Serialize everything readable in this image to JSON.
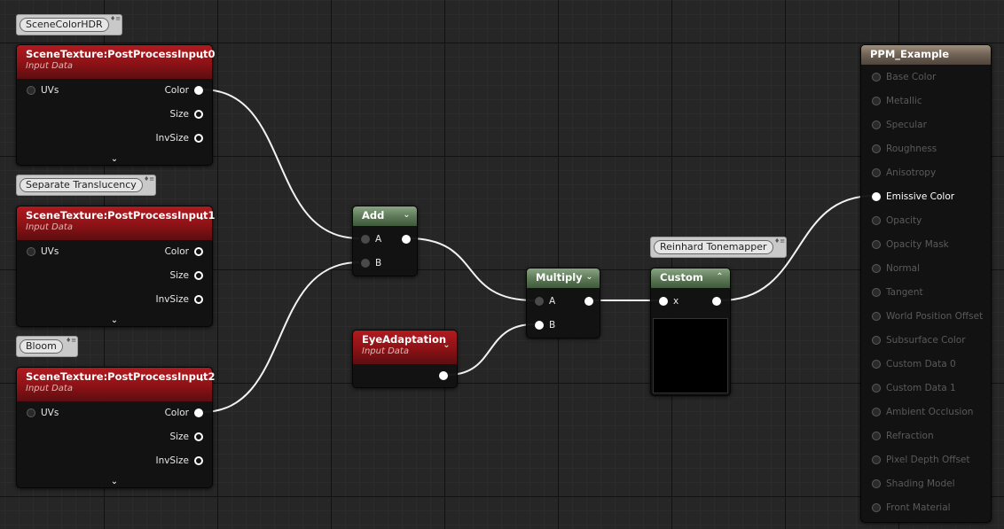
{
  "comments": {
    "scene_color_hdr": "SceneColorHDR",
    "separate_translucency": "Separate Translucency",
    "bloom": "Bloom",
    "reinhard": "Reinhard Tonemapper"
  },
  "comment_marker": "♦≡",
  "nodes": {
    "scene_texture_0": {
      "title": "SceneTexture:PostProcessInput0",
      "subtitle": "Input Data",
      "input_uvs": "UVs",
      "output_color": "Color",
      "output_size": "Size",
      "output_invsize": "InvSize"
    },
    "scene_texture_1": {
      "title": "SceneTexture:PostProcessInput1",
      "subtitle": "Input Data",
      "input_uvs": "UVs",
      "output_color": "Color",
      "output_size": "Size",
      "output_invsize": "InvSize"
    },
    "scene_texture_2": {
      "title": "SceneTexture:PostProcessInput2",
      "subtitle": "Input Data",
      "input_uvs": "UVs",
      "output_color": "Color",
      "output_size": "Size",
      "output_invsize": "InvSize"
    },
    "add": {
      "title": "Add",
      "input_a": "A",
      "input_b": "B"
    },
    "eye_adaptation": {
      "title": "EyeAdaptation",
      "subtitle": "Input Data"
    },
    "multiply": {
      "title": "Multiply",
      "input_a": "A",
      "input_b": "B"
    },
    "custom": {
      "title": "Custom",
      "input_x": "x"
    },
    "material_result": {
      "title": "PPM_Example",
      "active_pin": "Emissive Color",
      "pins": [
        "Base Color",
        "Metallic",
        "Specular",
        "Roughness",
        "Anisotropy",
        "Emissive Color",
        "Opacity",
        "Opacity Mask",
        "Normal",
        "Tangent",
        "World Position Offset",
        "Subsurface Color",
        "Custom Data 0",
        "Custom Data 1",
        "Ambient Occlusion",
        "Refraction",
        "Pixel Depth Offset",
        "Shading Model",
        "Front Material"
      ]
    }
  },
  "icons": {
    "collapse": "chevron-down-icon",
    "expand_more": "chevron-down-icon",
    "collapse_up": "chevron-up-icon"
  },
  "colors": {
    "input_node_header": "#9e1519",
    "math_node_header": "#5e7a58",
    "result_node_header": "#6f6154",
    "wire": "#f2f2f2",
    "graph_background": "#262626"
  }
}
